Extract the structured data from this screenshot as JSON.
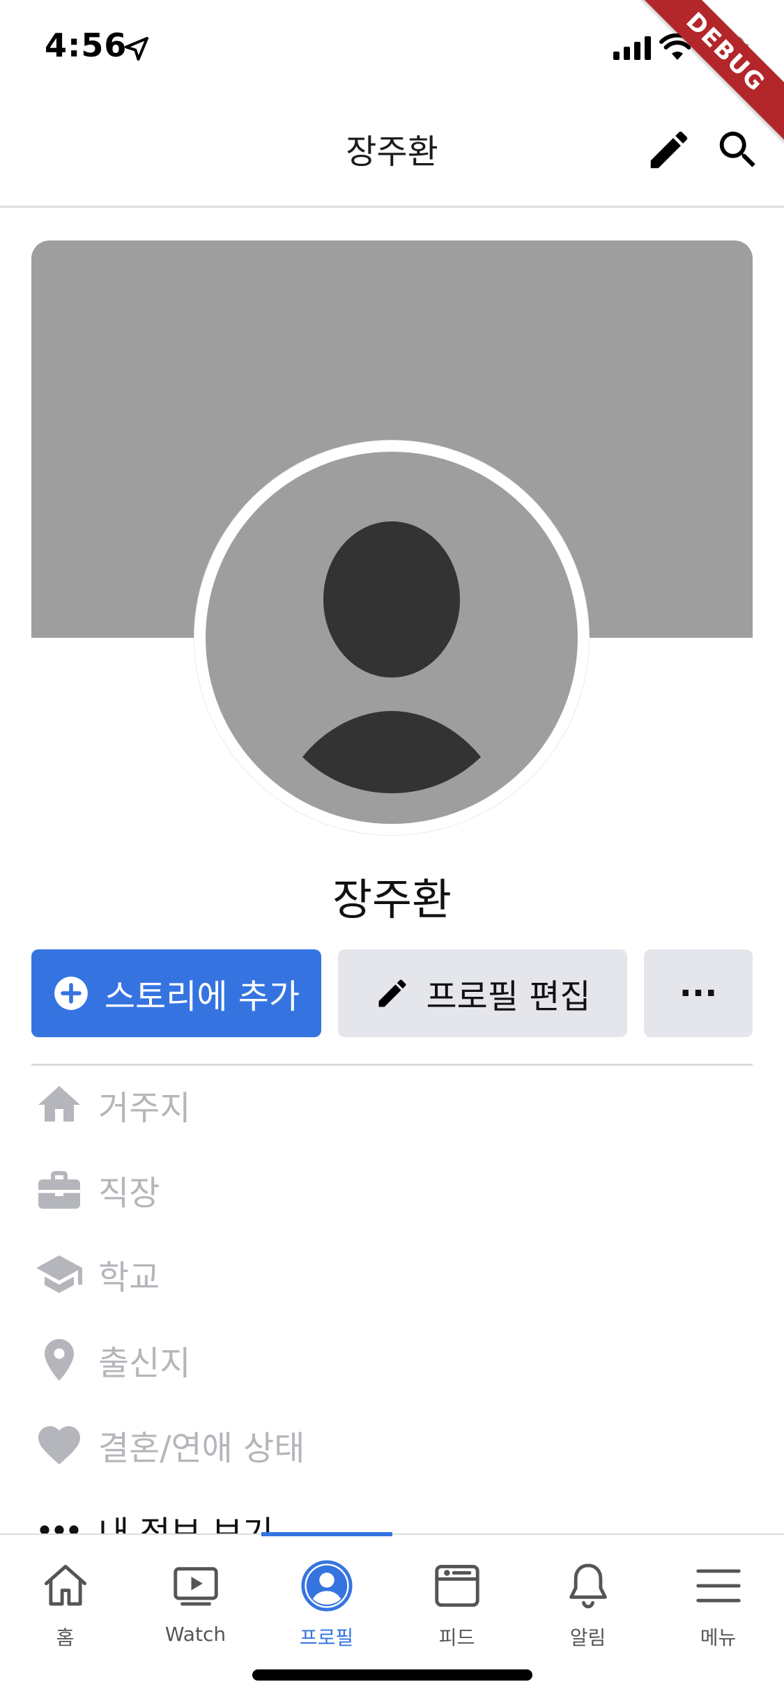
{
  "status_bar": {
    "time": "4:56",
    "icons": [
      "location-arrow-icon",
      "signal-icon",
      "wifi-icon",
      "battery-charging-icon"
    ]
  },
  "debug_banner": "DEBUG",
  "app_bar": {
    "title": "장주환",
    "actions": [
      "edit-pencil-icon",
      "search-icon"
    ]
  },
  "profile": {
    "name": "장주환",
    "avatar_icon": "person-silhouette-icon"
  },
  "actions": {
    "add_story": "스토리에 추가",
    "edit_profile": "프로필 편집",
    "more": "···"
  },
  "info": [
    {
      "icon": "home-icon",
      "label": "거주지"
    },
    {
      "icon": "briefcase-icon",
      "label": "직장"
    },
    {
      "icon": "graduation-cap-icon",
      "label": "학교"
    },
    {
      "icon": "location-pin-icon",
      "label": "출신지"
    },
    {
      "icon": "heart-icon",
      "label": "결혼/연애 상태"
    },
    {
      "icon": "more-dots-icon",
      "label": "내 정보 보기"
    }
  ],
  "bottom_nav": {
    "tabs": [
      {
        "label": "홈",
        "icon": "home-outline-icon"
      },
      {
        "label": "Watch",
        "icon": "watch-video-icon"
      },
      {
        "label": "프로필",
        "icon": "profile-circle-icon"
      },
      {
        "label": "피드",
        "icon": "feed-icon"
      },
      {
        "label": "알림",
        "icon": "bell-icon"
      },
      {
        "label": "메뉴",
        "icon": "menu-icon"
      }
    ],
    "active_index": 2
  },
  "colors": {
    "accent": "#3574e0",
    "button_gray": "#e4e6eb",
    "cover_gray": "#9e9e9e",
    "muted_text": "#b4b6bb",
    "debug_red": "#b3262a"
  }
}
